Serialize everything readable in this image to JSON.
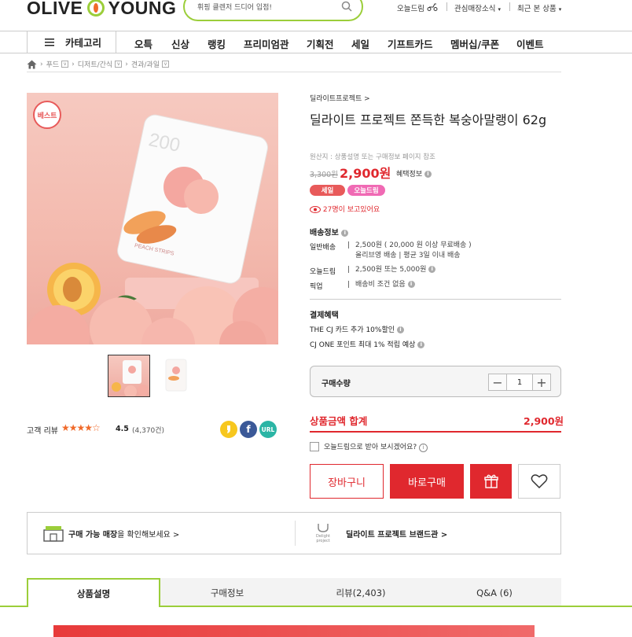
{
  "header": {
    "logo_left": "OLIVE",
    "logo_right": "YOUNG",
    "search_placeholder": "휘핑 클렌저 드디어 입점!",
    "util": [
      "오늘드림",
      "관심매장소식",
      "최근 본 상품"
    ]
  },
  "gnb": {
    "category_label": "카테고리",
    "items": [
      "오특",
      "신상",
      "랭킹",
      "프리미엄관",
      "기획전",
      "세일",
      "기프트카드",
      "멤버십/쿠폰",
      "이벤트"
    ]
  },
  "breadcrumb": [
    "푸드",
    "디저트/간식",
    "견과/과일"
  ],
  "gallery": {
    "badge": "베스트",
    "packet_text": "200",
    "packet_sub": "PEACH STRIPS"
  },
  "reviews": {
    "label": "고객 리뷰",
    "stars": "★★★★☆",
    "score": "4.5",
    "count": "(4,370건)",
    "share": [
      "URL"
    ]
  },
  "product": {
    "brand_link": "딜라이트프로젝트 >",
    "title": "딜라이트 프로젝트 쫀득한 복숭아말랭이 62g",
    "origin": "원산지 : 상품설명 또는 구매정보 페이지 참조",
    "old_price": "3,300원",
    "price": "2,900원",
    "benefit_label": "혜택정보",
    "tags": [
      "세일",
      "오늘드림"
    ],
    "viewing": "27명이 보고있어요"
  },
  "delivery": {
    "title": "배송정보",
    "rows": [
      {
        "label": "일반배송",
        "value": "2,500원 ( 20,000 원 이상 무료배송 )",
        "value2": "올리브영 배송 | 평균 3일 이내 배송"
      },
      {
        "label": "오늘드림",
        "value": "2,500원 또는 5,000원"
      },
      {
        "label": "픽업",
        "value": "배송비 조건 없음"
      }
    ]
  },
  "payment": {
    "title": "결제혜택",
    "rows": [
      "THE CJ 카드 추가 10%할인",
      "CJ ONE 포인트 최대 1% 적립 예상"
    ]
  },
  "quantity": {
    "label": "구매수량",
    "value": "1"
  },
  "total": {
    "label": "상품금액 합계",
    "value": "2,900원"
  },
  "today_option": "오늘드림으로 받아 보시겠어요?",
  "buttons": {
    "cart": "장바구니",
    "buy": "바로구매"
  },
  "store_bar": {
    "store_bold": "구매 가능 매장",
    "store_rest": "을 확인해보세요 >",
    "brand_logo": "Delight project",
    "brand_link": "딜라이트 프로젝트 브랜드관 >"
  },
  "tabs": [
    "상품설명",
    "구매정보",
    "리뷰(2,403)",
    "Q&A (6)"
  ],
  "colors": {
    "accent": "#e0282e",
    "brand_green": "#9bce3a",
    "pink_tag": "#f06ab4"
  }
}
